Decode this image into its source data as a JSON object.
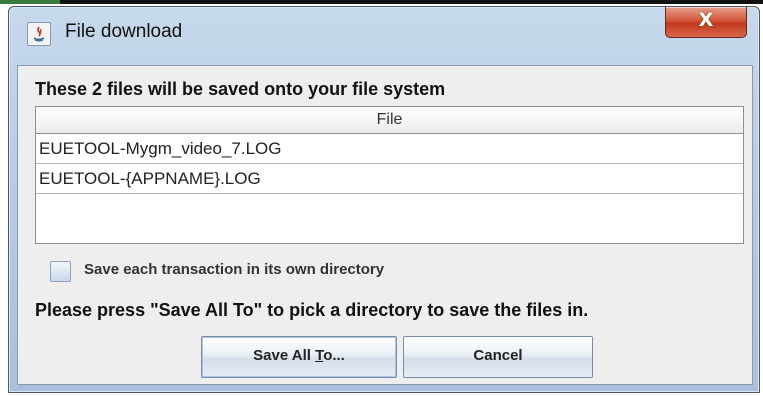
{
  "window": {
    "title": "File download",
    "close_label": "X"
  },
  "dialog": {
    "heading": "These 2 files will be saved onto your file system",
    "table": {
      "column_header": "File",
      "rows": [
        "EUETOOL-Mygm_video_7.LOG",
        "EUETOOL-{APPNAME}.LOG"
      ]
    },
    "checkbox": {
      "label": "Save each transaction in its own directory",
      "checked": false
    },
    "instruction": "Please press \"Save All To\" to pick a directory to save the files in.",
    "buttons": {
      "save_all_prefix": "Save All ",
      "save_all_mnemonic": "T",
      "save_all_suffix": "o...",
      "cancel": "Cancel"
    }
  },
  "icons": {
    "window_icon": "java-app-icon",
    "close": "close-icon"
  }
}
